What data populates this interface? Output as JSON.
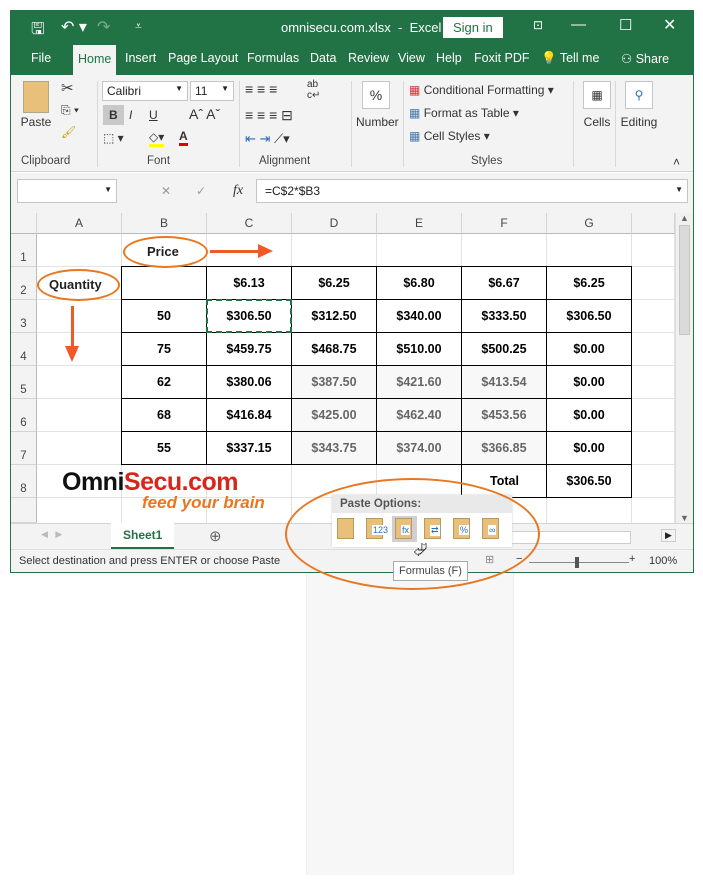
{
  "title_bar": {
    "doc_title": "omnisecu.com.xlsx  -  Excel",
    "sign_in": "Sign in"
  },
  "tabs": [
    "File",
    "Home",
    "Insert",
    "Page Layout",
    "Formulas",
    "Data",
    "Review",
    "View",
    "Help",
    "Foxit PDF",
    "Tell me",
    "Share"
  ],
  "active_tab": "Home",
  "ribbon": {
    "clipboard": {
      "paste": "Paste",
      "label": "Clipboard"
    },
    "font": {
      "name": "Calibri",
      "size": "11",
      "label": "Font",
      "bold": "B",
      "italic": "I",
      "underline": "U"
    },
    "alignment": {
      "label": "Alignment"
    },
    "number": {
      "label": "Number",
      "symbol": "%"
    },
    "styles": {
      "conditional": "Conditional Formatting",
      "format_table": "Format as Table",
      "cell_styles": "Cell Styles",
      "label": "Styles"
    },
    "cells": "Cells",
    "editing": "Editing"
  },
  "formula_bar": {
    "name_box": "",
    "fx": "fx",
    "formula": "=C$2*$B3"
  },
  "columns": [
    "A",
    "B",
    "C",
    "D",
    "E",
    "F",
    "G"
  ],
  "rows": [
    "1",
    "2",
    "3",
    "4",
    "5",
    "6",
    "7",
    "8"
  ],
  "annotations": {
    "price": "Price",
    "quantity": "Quantity"
  },
  "prices": [
    "$6.13",
    "$6.25",
    "$6.80",
    "$6.67",
    "$6.25"
  ],
  "table": [
    {
      "qty": "50",
      "values": [
        "$306.50",
        "$312.50",
        "$340.00",
        "$333.50",
        "$306.50"
      ]
    },
    {
      "qty": "75",
      "values": [
        "$459.75",
        "$468.75",
        "$510.00",
        "$500.25",
        "$0.00"
      ]
    },
    {
      "qty": "62",
      "values": [
        "$380.06",
        "$387.50",
        "$421.60",
        "$413.54",
        "$0.00"
      ]
    },
    {
      "qty": "68",
      "values": [
        "$416.84",
        "$425.00",
        "$462.40",
        "$453.56",
        "$0.00"
      ]
    },
    {
      "qty": "55",
      "values": [
        "$337.15",
        "$343.75",
        "$374.00",
        "$366.85",
        "$0.00"
      ]
    }
  ],
  "total": {
    "label": "Total",
    "value": "$306.50"
  },
  "logo": {
    "name": "OmniSecu.com",
    "tagline": "feed your brain"
  },
  "sheet_tab": "Sheet1",
  "paste_options": {
    "title": "Paste Options:",
    "tooltip": "Formulas (F)",
    "icons": [
      "paste-icon",
      "paste-values-icon",
      "paste-formulas-icon",
      "paste-transpose-icon",
      "paste-formatting-icon",
      "paste-link-icon"
    ]
  },
  "status": {
    "message": "Select destination and press ENTER or choose Paste",
    "zoom": "100%"
  },
  "colors": {
    "excel_green": "#217346",
    "annotation_orange": "#e87722"
  }
}
